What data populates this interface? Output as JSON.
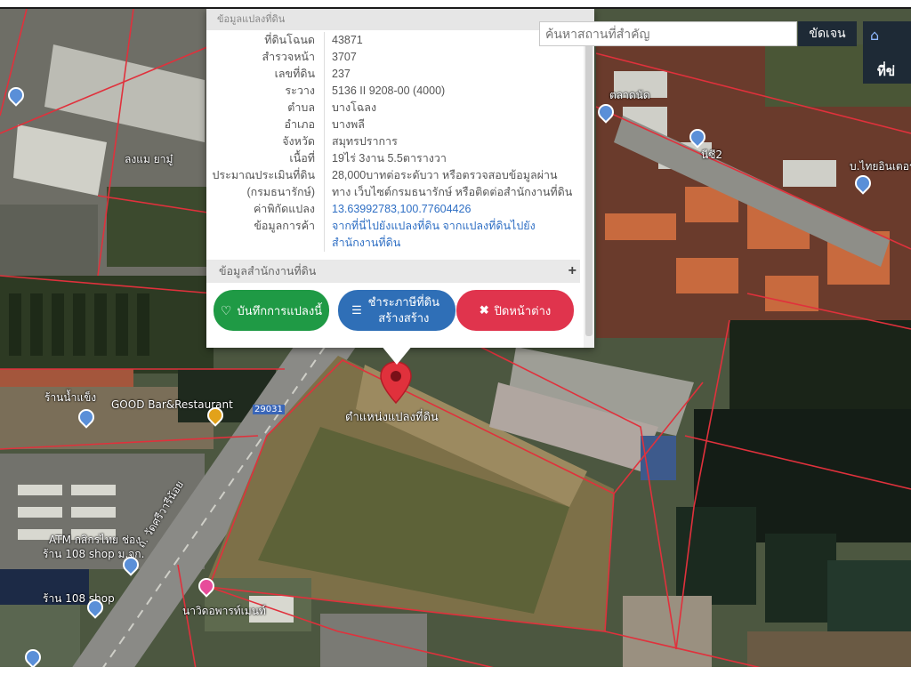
{
  "search": {
    "placeholder": "ค้นหาสถานที่สำคัญ",
    "button_label": "ขัดเจน"
  },
  "corner": {
    "home_icon": "home-icon",
    "label": "ที่ข่"
  },
  "popup": {
    "header_label": "ข้อมูลแปลงที่ดิน",
    "rows": [
      {
        "label": "ที่ดินโฉนด",
        "value": "43871"
      },
      {
        "label": "สำรวจหน้า",
        "value": "3707"
      },
      {
        "label": "เลขที่ดิน",
        "value": "237"
      },
      {
        "label": "ระวาง",
        "value": "5136 II 9208-00 (4000)"
      },
      {
        "label": "ตำบล",
        "value": "บางโฉลง"
      },
      {
        "label": "อำเภอ",
        "value": "บางพลี"
      },
      {
        "label": "จังหวัด",
        "value": "สมุทรปราการ"
      },
      {
        "label": "เนื้อที่",
        "value": "19ไร่ 3งาน 5.5ตารางวา"
      },
      {
        "label": "ประมาณประเมินที่ดิน",
        "value": "28,000บาทต่อระดับวา หรือตรวจสอบข้อมูลผ่าน"
      },
      {
        "label": "(กรมธนารักษ์)",
        "value": "ทาง เว็บไซต์กรมธนารักษ์ หรือติดต่อสำนักงานที่ดิน"
      },
      {
        "label": "ค่าพิกัดแปลง",
        "value": "13.63992783,100.77604426",
        "link": true
      },
      {
        "label": "ข้อมูลการค้า",
        "value": "จากที่นี่ไปยังแปลงที่ดิน จากแปลงที่ดินไปยัง",
        "link": true
      },
      {
        "label": "",
        "value": "สำนักงานที่ดิน",
        "link": true
      }
    ],
    "section_label": "ข้อมูลสำนักงานที่ดิน",
    "section_toggle": "+",
    "buttons": {
      "save": "บันทึกการแปลงนี้",
      "pay": "ชำระภาษีที่ดิน สร้างสร้าง",
      "close": "ปิดหน้าต่าง"
    },
    "icons": {
      "save": "heart-icon",
      "pay": "list-icon",
      "close": "close-icon"
    }
  },
  "map": {
    "parcel_label": "ตำแหน่งแปลงที่ดิน",
    "labels": [
      "GOOD Bar&Restaurant",
      "ร้านน้ำแข็ง",
      "ATM กสิกรไทย ช่อง",
      "ร้าน 108 shop ม.จก.",
      "ร้าน 108 shop",
      "นาวิดอพารท์เมนท์",
      "ถ. วัดศรีวารีน้อย",
      "ตลาดนัด",
      "นีซี2",
      "บ.ไทยอินเตอร์",
      "29031"
    ],
    "colors": {
      "boundary": "#e0313c",
      "pin": "#e0313c",
      "road": "#8a8a86"
    }
  }
}
